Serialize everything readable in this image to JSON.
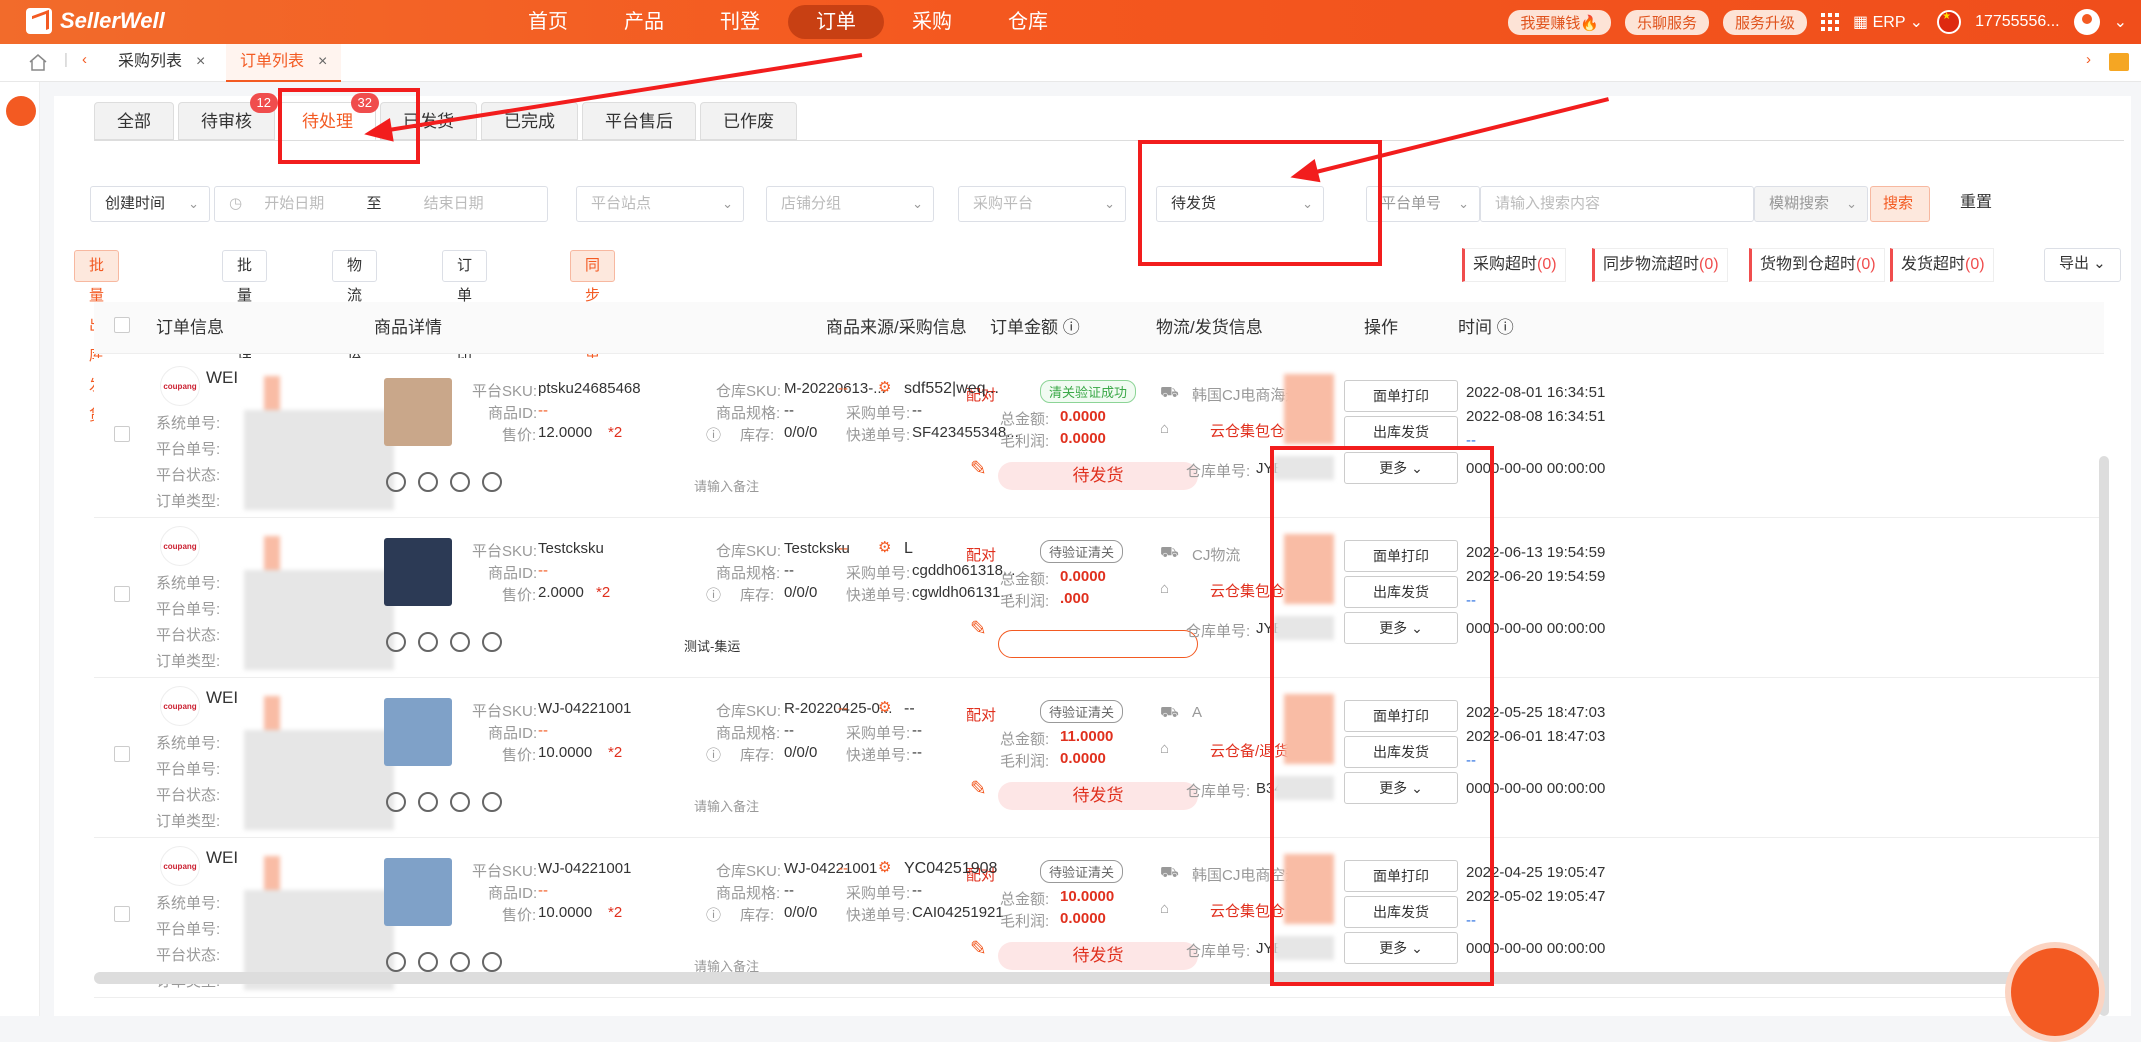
{
  "app": {
    "brand": "SellerWell",
    "nav": [
      "首页",
      "产品",
      "刊登",
      "订单",
      "采购",
      "仓库"
    ],
    "active_nav": "订单",
    "pills": [
      "我要赚钱🔥",
      "乐聊服务",
      "服务升级"
    ],
    "erp": "ERP",
    "user": "17755556..."
  },
  "tabs": [
    {
      "label": "采购列表",
      "close": "×"
    },
    {
      "label": "订单列表",
      "close": "×"
    }
  ],
  "subtabs": [
    {
      "label": "全部",
      "badge": ""
    },
    {
      "label": "待审核",
      "badge": "12"
    },
    {
      "label": "待处理",
      "badge": "32"
    },
    {
      "label": "已发货",
      "badge": ""
    },
    {
      "label": "已完成",
      "badge": ""
    },
    {
      "label": "平台售后",
      "badge": ""
    },
    {
      "label": "已作废",
      "badge": ""
    }
  ],
  "filters": {
    "created_time": "创建时间",
    "start_date": "开始日期",
    "to": "至",
    "end_date": "结束日期",
    "site": "平台站点",
    "shop_group": "店铺分组",
    "purchase_platform": "采购平台",
    "status": "待发货",
    "order_no": "平台单号",
    "search_placeholder": "请输入搜索内容",
    "fuzzy": "模糊搜索",
    "search": "搜索",
    "reset": "重置"
  },
  "actions": [
    "批量出库发货",
    "批量处理",
    "物流交运",
    "订单打印",
    "同步订单"
  ],
  "alerts": [
    {
      "label": "采购超时",
      "count": "(0)"
    },
    {
      "label": "同步物流超时",
      "count": "(0)"
    },
    {
      "label": "货物到仓超时",
      "count": "(0)"
    },
    {
      "label": "发货超时",
      "count": "(0)"
    }
  ],
  "export": "导出",
  "columns": [
    "订单信息",
    "商品详情",
    "商品来源/采购信息",
    "订单金额",
    "物流/发货信息",
    "操作",
    "时间"
  ],
  "labels": {
    "sys_no": "系统单号:",
    "plat_no": "平台单号:",
    "plat_status": "平台状态:",
    "order_type": "订单类型:",
    "plat_sku": "平台SKU:",
    "goods_id": "商品ID:",
    "price": "售价:",
    "wh_sku": "仓库SKU:",
    "spec": "商品规格:",
    "stock": "库存:",
    "purchase_no": "采购单号:",
    "express_no": "快递单号:",
    "total": "总金额:",
    "profit": "毛利润:",
    "wh_order_no": "仓库单号:",
    "match": "配对",
    "more": "更多",
    "print": "面单打印",
    "outbound": "出库发货",
    "remark_placeholder": "请输入备注"
  },
  "rows": [
    {
      "shop": "WEI",
      "sku": "ptsku24685468",
      "goods_id": "--",
      "price": "12.0000",
      "qty": "*2",
      "wh_sku": "M-20220613-...",
      "spec": "--",
      "stock": "0/0/0",
      "src": "sdf552|weq...",
      "pur_no": "--",
      "exp_no": "SF423455348...",
      "tag": "清关验证成功",
      "total": "0.0000",
      "profit": "0.0000",
      "status": "待发货",
      "logistics": "韩国CJ电商海运",
      "warehouse": "云仓集包仓",
      "wh_no": "JYB",
      "remark": "请输入备注",
      "t1": "2022-08-01 16:34:51",
      "t2": "2022-08-08 16:34:51",
      "t3": "--",
      "t4": "0000-00-00 00:00:00"
    },
    {
      "shop": "",
      "sku": "Testcksku",
      "goods_id": "--",
      "price": "2.0000",
      "qty": "*2",
      "wh_sku": "Testcksku",
      "spec": "--",
      "stock": "0/0/0",
      "src": "L",
      "pur_no": "cgddh061318...",
      "exp_no": "cgwldh06131...",
      "tag": "待验证清关",
      "total": "0.0000",
      "profit": ".000",
      "status": "",
      "logistics": "CJ物流",
      "warehouse": "云仓集包仓",
      "wh_no": "JYB",
      "remark": "测试-集运",
      "t1": "2022-06-13 19:54:59",
      "t2": "2022-06-20 19:54:59",
      "t3": "--",
      "t4": "0000-00-00 00:00:00"
    },
    {
      "shop": "WEI",
      "sku": "WJ-04221001",
      "goods_id": "--",
      "price": "10.0000",
      "qty": "*2",
      "wh_sku": "R-20220425-0...",
      "spec": "--",
      "stock": "0/0/0",
      "src": "--",
      "pur_no": "--",
      "exp_no": "--",
      "tag": "待验证清关",
      "total": "11.0000",
      "profit": "0.0000",
      "status": "待发货",
      "logistics": "A",
      "warehouse": "云仓备/退货",
      "wh_no": "B34",
      "remark": "请输入备注",
      "t1": "2022-05-25 18:47:03",
      "t2": "2022-06-01 18:47:03",
      "t3": "--",
      "t4": "0000-00-00 00:00:00"
    },
    {
      "shop": "WEI",
      "sku": "WJ-04221001",
      "goods_id": "--",
      "price": "10.0000",
      "qty": "*2",
      "wh_sku": "WJ-04221001",
      "spec": "--",
      "stock": "0/0/0",
      "src": "YC04251908",
      "pur_no": "--",
      "exp_no": "CAI04251921",
      "tag": "待验证清关",
      "total": "10.0000",
      "profit": "0.0000",
      "status": "待发货",
      "logistics": "韩国CJ电商空运",
      "warehouse": "云仓集包仓",
      "wh_no": "JYB",
      "remark": "请输入备注",
      "t1": "2022-04-25 19:05:47",
      "t2": "2022-05-02 19:05:47",
      "t3": "--",
      "t4": "0000-00-00 00:00:00"
    }
  ],
  "colors": {
    "brand": "#f35a22",
    "annotation": "#f21d1d"
  }
}
